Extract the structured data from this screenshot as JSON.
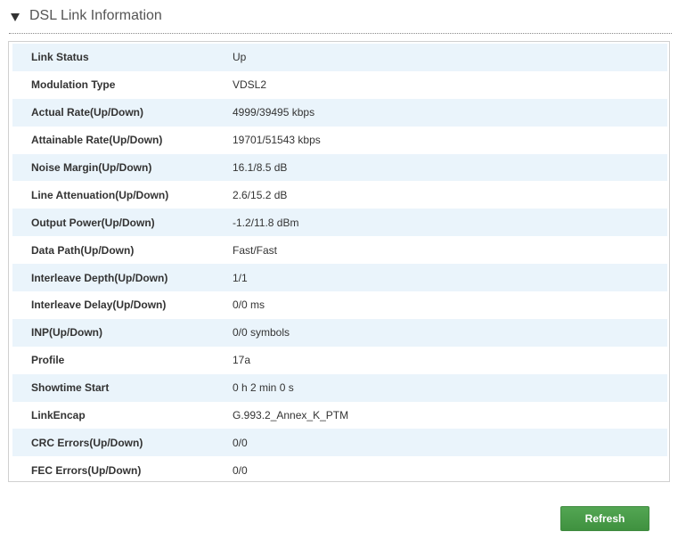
{
  "section": {
    "title": "DSL Link Information"
  },
  "rows": [
    {
      "label": "Link Status",
      "value": "Up"
    },
    {
      "label": "Modulation Type",
      "value": "VDSL2"
    },
    {
      "label": "Actual Rate(Up/Down)",
      "value": "4999/39495 kbps"
    },
    {
      "label": "Attainable Rate(Up/Down)",
      "value": "19701/51543 kbps"
    },
    {
      "label": "Noise Margin(Up/Down)",
      "value": "16.1/8.5 dB"
    },
    {
      "label": "Line Attenuation(Up/Down)",
      "value": "2.6/15.2 dB"
    },
    {
      "label": "Output Power(Up/Down)",
      "value": "-1.2/11.8 dBm"
    },
    {
      "label": "Data Path(Up/Down)",
      "value": "Fast/Fast"
    },
    {
      "label": "Interleave Depth(Up/Down)",
      "value": "1/1"
    },
    {
      "label": "Interleave Delay(Up/Down)",
      "value": "0/0 ms"
    },
    {
      "label": "INP(Up/Down)",
      "value": "0/0 symbols"
    },
    {
      "label": "Profile",
      "value": "17a"
    },
    {
      "label": "Showtime Start",
      "value": "0 h 2 min 0 s"
    },
    {
      "label": "LinkEncap",
      "value": "G.993.2_Annex_K_PTM"
    },
    {
      "label": "CRC Errors(Up/Down)",
      "value": "0/0"
    },
    {
      "label": "FEC Errors(Up/Down)",
      "value": "0/0"
    }
  ],
  "actions": {
    "refresh_label": "Refresh"
  },
  "colors": {
    "row_stripe": "#eaf4fb",
    "button_green": "#4a9e4a"
  }
}
